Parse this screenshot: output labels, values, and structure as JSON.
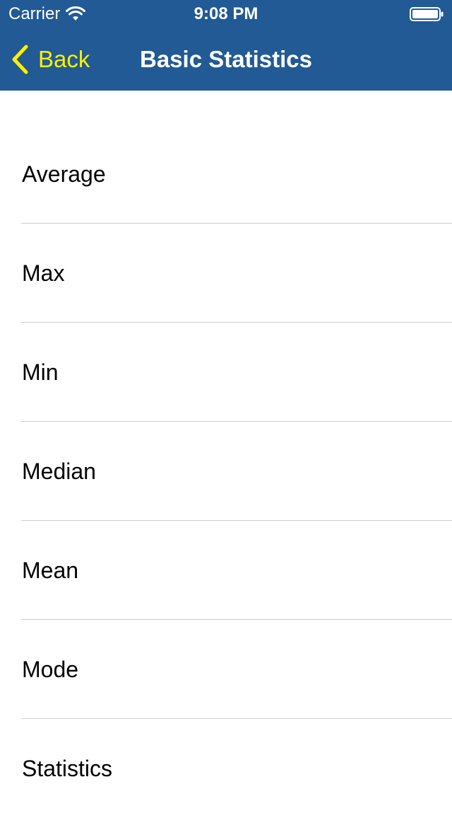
{
  "status_bar": {
    "carrier": "Carrier",
    "time": "9:08 PM",
    "wifi_icon": "wifi-icon",
    "battery_icon": "battery-icon"
  },
  "nav": {
    "back_label": "Back",
    "back_icon": "chevron-left-icon",
    "title": "Basic Statistics"
  },
  "colors": {
    "nav_background": "#215a94",
    "back_tint": "#ffef00",
    "title_text": "#ffffff",
    "divider": "#cccccc"
  },
  "list": {
    "items": [
      {
        "label": "Average"
      },
      {
        "label": "Max"
      },
      {
        "label": "Min"
      },
      {
        "label": "Median"
      },
      {
        "label": "Mean"
      },
      {
        "label": "Mode"
      },
      {
        "label": "Statistics"
      }
    ]
  }
}
